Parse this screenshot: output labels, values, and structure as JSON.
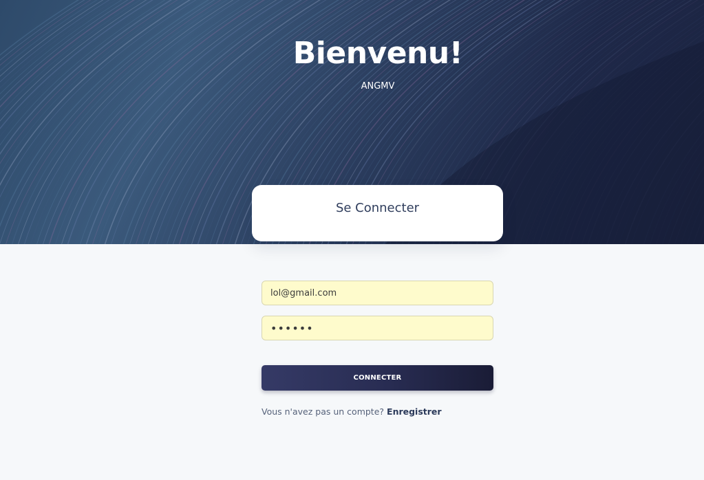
{
  "hero": {
    "title": "Bienvenu!",
    "subtitle": "ANGMV",
    "background_colors": [
      "#2e4a6a",
      "#3b5a7c",
      "#1b2340"
    ]
  },
  "login_card": {
    "title": "Se Connecter"
  },
  "form": {
    "email_value": "lol@gmail.com",
    "password_masked": "••••••",
    "submit_label": "CONNECTER",
    "field_fill_color": "#fefbcc"
  },
  "register": {
    "prompt": "Vous n'avez pas un compte?",
    "link_label": "Enregistrer"
  },
  "colors": {
    "page_background": "#f6f8fa",
    "button_dark": "#1a1c36",
    "title_text": "#2f3d5c"
  }
}
